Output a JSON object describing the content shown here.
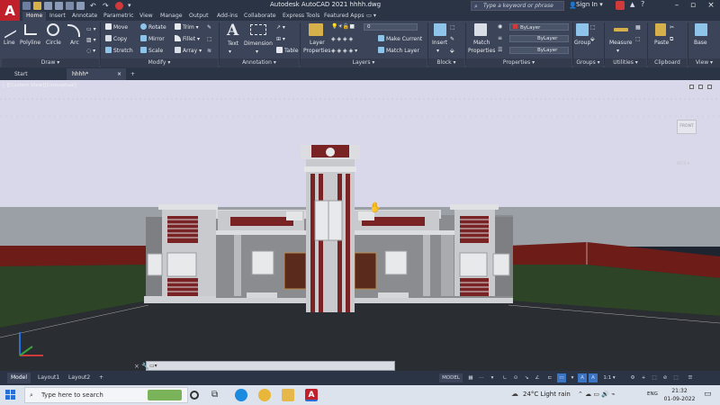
{
  "app": {
    "logo": "A",
    "title": "Autodesk AutoCAD 2021   hhhh.dwg"
  },
  "search": {
    "placeholder": "Type a keyword or phrase"
  },
  "account": {
    "signin": "Sign In"
  },
  "ribbon_tabs": [
    "Home",
    "Insert",
    "Annotate",
    "Parametric",
    "View",
    "Manage",
    "Output",
    "Add-ins",
    "Collaborate",
    "Express Tools",
    "Featured Apps"
  ],
  "draw": {
    "line": "Line",
    "polyline": "Polyline",
    "circle": "Circle",
    "arc": "Arc",
    "title": "Draw ▾"
  },
  "modify": {
    "move": "Move",
    "rotate": "Rotate",
    "trim": "Trim",
    "copy": "Copy",
    "mirror": "Mirror",
    "fillet": "Fillet",
    "stretch": "Stretch",
    "scale": "Scale",
    "array": "Array",
    "title": "Modify ▾"
  },
  "annotation": {
    "text": "Text",
    "dimension": "Dimension",
    "table": "Table",
    "title": "Annotation ▾"
  },
  "layers": {
    "layer_properties_1": "Layer",
    "layer_properties_2": "Properties",
    "current_layer": "0",
    "make_current": "Make Current",
    "match_layer": "Match Layer",
    "title": "Layers ▾"
  },
  "block": {
    "insert": "Insert",
    "title": "Block ▾"
  },
  "properties": {
    "match_1": "Match",
    "match_2": "Properties",
    "color": "ByLayer",
    "linetype": "ByLayer",
    "lineweight": "ByLayer",
    "title": "Properties ▾"
  },
  "groups": {
    "group": "Group",
    "title": "Groups ▾"
  },
  "utilities": {
    "measure": "Measure",
    "title": "Utilities ▾"
  },
  "clipboard": {
    "paste": "Paste",
    "title": "Clipboard"
  },
  "view": {
    "base": "Base",
    "title": "View ▾"
  },
  "doc_tabs": {
    "start": "Start",
    "drawing": "hhhh*",
    "add": "+"
  },
  "viewport": {
    "label": "[-][Custom View][Conceptual]",
    "viewcube": "FRONT",
    "wcs": "WCS ▾"
  },
  "layout_tabs": {
    "model": "Model",
    "layout1": "Layout1",
    "layout2": "Layout2",
    "add": "+"
  },
  "status": {
    "model": "MODEL",
    "scale": "1:1 ▾"
  },
  "taskbar": {
    "search": "Type here to search",
    "weather": "24°C  Light rain",
    "lang": "ENG",
    "time": "21:32",
    "date": "01-09-2022"
  },
  "colors": {
    "accent": "#c0202a",
    "ribbon_bg": "#3b4458",
    "building_red": "#7a2325",
    "sky": "#d9d8ea"
  }
}
